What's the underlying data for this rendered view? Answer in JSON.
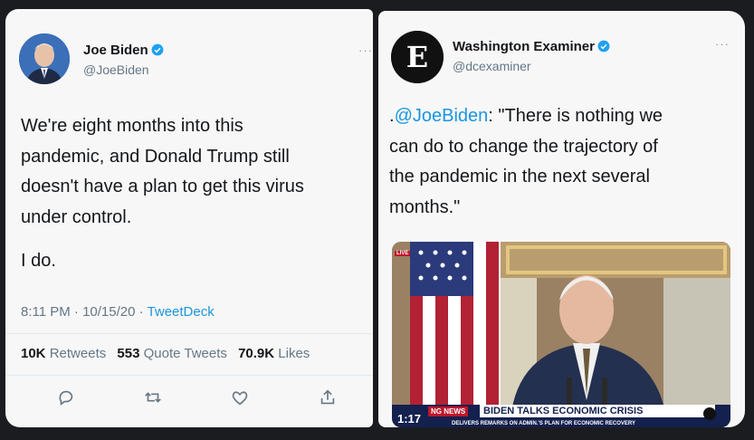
{
  "left_tweet": {
    "name": "Joe Biden",
    "handle": "@JoeBiden",
    "more": "···",
    "body_lines": [
      "We're eight months into this",
      "pandemic, and Donald Trump still",
      "doesn't have a plan to get this virus",
      "under control."
    ],
    "body_second": "I do.",
    "time": "8:11 PM · 10/15/20 · ",
    "source": "TweetDeck",
    "retweets_count": "10K",
    "retweets_label": "Retweets",
    "quotes_count": "553",
    "quotes_label": "Quote Tweets",
    "likes_count": "70.9K",
    "likes_label": "Likes",
    "actions": [
      "reply-icon",
      "retweet-icon",
      "like-icon",
      "share-icon"
    ]
  },
  "right_tweet": {
    "name": "Washington Examiner",
    "handle": "@dcexaminer",
    "more": "···",
    "logo_letter": "E",
    "body_prefix": ".",
    "body_mention": "@JoeBiden",
    "body_lines_first_rest": ": \"There is nothing we",
    "body_lines": [
      "can do to change the trajectory of",
      "the pandemic in the next several",
      "months.\""
    ],
    "news": {
      "live": "LIVE",
      "time": "1:17",
      "label": "NG NEWS",
      "headline": "BIDEN TALKS ECONOMIC CRISIS",
      "subheadline": "DELIVERS REMARKS ON ADMIN.'S PLAN FOR ECONOMIC RECOVERY"
    }
  },
  "colors": {
    "link": "#1b95e0",
    "verified": "#1da1f2",
    "icon": "#657786",
    "text": "#14171a"
  }
}
